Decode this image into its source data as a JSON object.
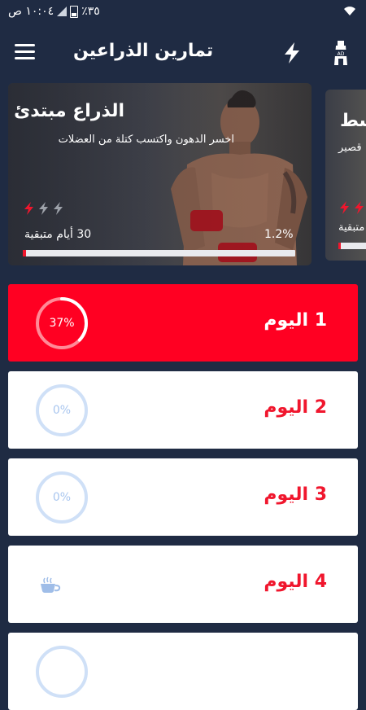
{
  "status_bar": {
    "time": "١٠:٠٤ ص",
    "battery": "٪٣٥"
  },
  "header": {
    "title": "تمارين الذراعين"
  },
  "programs": [
    {
      "title": "الذراع مبتدئ",
      "subtitle": "اخسر الدهون واكتسب كتلة من العضلات",
      "days_left": "30 أيام متبقية",
      "percent_label": "1.2%",
      "progress": 0.012,
      "level": 1
    },
    {
      "title": "سط",
      "subtitle": "قصير",
      "days_left": "متبقية",
      "level": 2
    }
  ],
  "days": [
    {
      "label": "1 اليوم",
      "progress_label": "37%",
      "progress": 0.37,
      "active": true
    },
    {
      "label": "2 اليوم",
      "progress_label": "0%",
      "progress": 0
    },
    {
      "label": "3 اليوم",
      "progress_label": "0%",
      "progress": 0
    },
    {
      "label": "4 اليوم",
      "icon": "coffee-cup-icon",
      "rest_day": true
    }
  ],
  "colors": {
    "background": "#1f2b43",
    "accent": "#ff0022",
    "ring_inactive": "#cfe0f7"
  }
}
